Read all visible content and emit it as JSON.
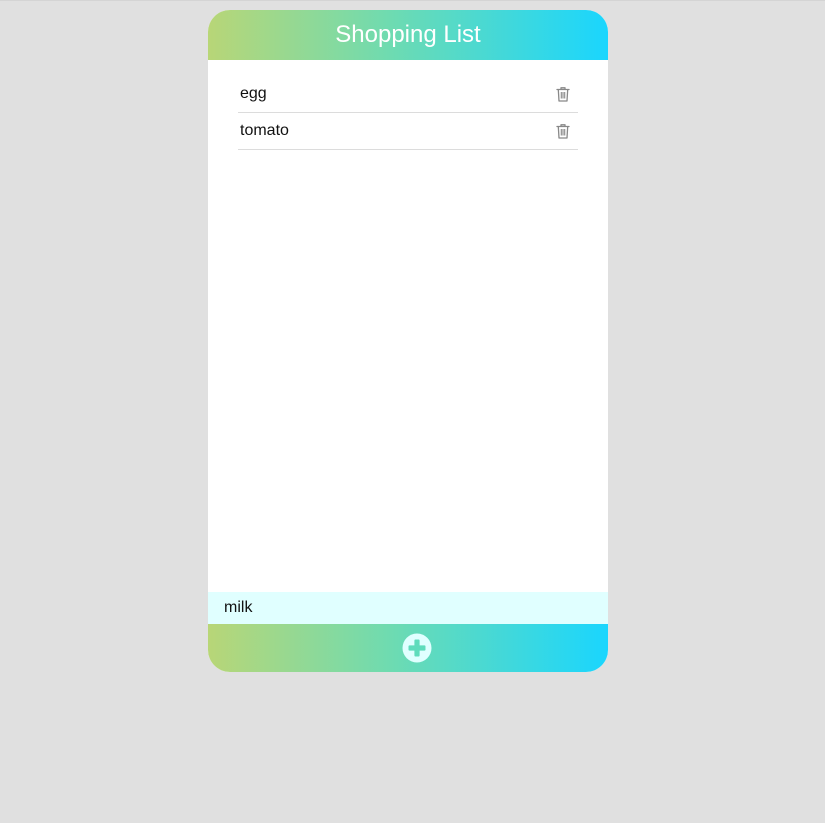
{
  "header": {
    "title": "Shopping List"
  },
  "list": {
    "items": [
      {
        "label": "egg",
        "action_icon": "trash-icon"
      },
      {
        "label": "tomato",
        "action_icon": "trash-icon"
      }
    ]
  },
  "input": {
    "value": "milk"
  },
  "footer": {
    "add_icon": "plus-circle-icon"
  },
  "colors": {
    "page_background": "#e0e0e0",
    "gradient_start": "#b8d677",
    "gradient_mid": "#6fdbb0",
    "gradient_end": "#1ad6fe",
    "input_background": "#e0ffff",
    "add_icon_fill": "#e0ffff",
    "add_icon_cross": "#5fdcbc",
    "trash_icon": "#888888"
  }
}
